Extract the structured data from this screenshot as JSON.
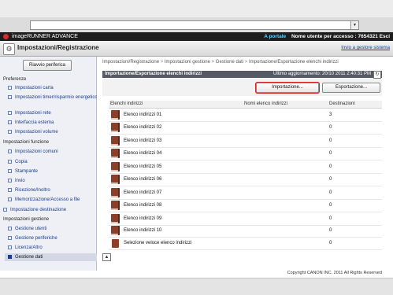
{
  "browser": {
    "address_value": ""
  },
  "header": {
    "product": "imageRUNNER ADVANCE",
    "portal_link": "A portale",
    "user_label": "Nome utente per accesso : 7654321 Esci"
  },
  "title": {
    "text": "Impostazioni/Registrazione",
    "link": "Invio a gestore sistema"
  },
  "sidebar": {
    "restart_button": "Riavvio periferica",
    "sections": [
      {
        "heading": "Preferenze",
        "items": [
          "Impostazioni carta",
          "Impostazioni timer/risparmio energetico",
          "Impostazioni rete",
          "Interfaccia esterna",
          "Impostazioni volume"
        ]
      },
      {
        "heading": "Impostazioni funzione",
        "items": [
          "Impostazioni comuni",
          "Copia",
          "Stampante",
          "Invio",
          "Ricezione/Inoltro",
          "Memorizzazione/Accesso a file"
        ]
      },
      {
        "heading": "Impostazione destinazione",
        "items": []
      },
      {
        "heading": "Impostazioni gestione",
        "items": [
          "Gestione utenti",
          "Gestione periferiche",
          "Licenza/Altro",
          "Gestione dati"
        ]
      }
    ]
  },
  "breadcrumb": [
    "Impostazioni/Registrazione",
    "Impostazioni gestione",
    "Gestione dati",
    "Importazione/Esportazione elenchi indirizzi"
  ],
  "panel": {
    "title": "Importazione/Esportazione elenchi indirizzi",
    "updated": "Ultimo aggiornamento: 20/10 2011 2:40:31 PM",
    "import_button": "Importazione...",
    "export_button": "Esportazione..."
  },
  "table": {
    "columns": [
      "Elenchi indirizzi",
      "Nomi elenco indirizzi",
      "Destinazioni"
    ],
    "rows": [
      {
        "name": "Elenco indirizzi 01",
        "dest": "3"
      },
      {
        "name": "Elenco indirizzi 02",
        "dest": "0"
      },
      {
        "name": "Elenco indirizzi 03",
        "dest": "0"
      },
      {
        "name": "Elenco indirizzi 04",
        "dest": "0"
      },
      {
        "name": "Elenco indirizzi 05",
        "dest": "0"
      },
      {
        "name": "Elenco indirizzi 06",
        "dest": "0"
      },
      {
        "name": "Elenco indirizzi 07",
        "dest": "0"
      },
      {
        "name": "Elenco indirizzi 08",
        "dest": "0"
      },
      {
        "name": "Elenco indirizzi 09",
        "dest": "0"
      },
      {
        "name": "Elenco indirizzi 10",
        "dest": "0"
      },
      {
        "name": "Selezione veloce elenco indirizzi",
        "dest": "0"
      }
    ]
  },
  "footer": {
    "copyright": "Copyright CANON INC. 2011 All Rights Reserved"
  },
  "colors": {
    "accent": "#1a3c8c",
    "highlight": "#cf2a2a",
    "header_bg": "#1d1d1d"
  },
  "icons": [
    "canon-logo-icon",
    "settings-icon",
    "refresh-icon",
    "address-book-icon",
    "scroll-top-icon"
  ]
}
